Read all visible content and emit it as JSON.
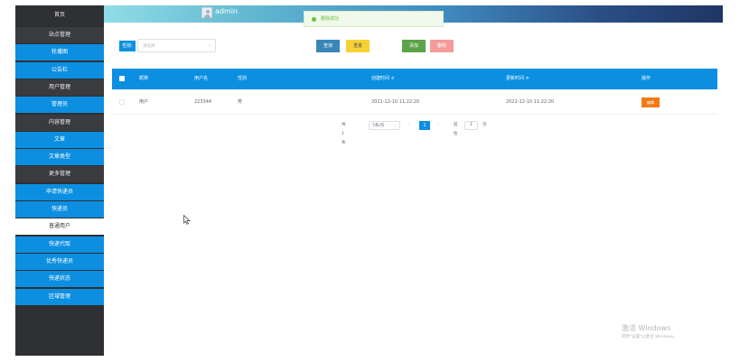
{
  "sidebar": {
    "home": "首页",
    "collapse": "已收缩",
    "items": [
      {
        "label": "站点管理",
        "kind": "cat"
      },
      {
        "label": "轮播图",
        "kind": "sub"
      },
      {
        "label": "公告栏",
        "kind": "sub"
      },
      {
        "label": "用户管理",
        "kind": "cat"
      },
      {
        "label": "管理员",
        "kind": "sub"
      },
      {
        "label": "内容管理",
        "kind": "cat"
      },
      {
        "label": "文章",
        "kind": "sub"
      },
      {
        "label": "文章类型",
        "kind": "sub"
      },
      {
        "label": "更多管理",
        "kind": "cat"
      },
      {
        "label": "申请快递员",
        "kind": "sub"
      },
      {
        "label": "快递员",
        "kind": "sub"
      },
      {
        "label": "普通用户",
        "kind": "active"
      },
      {
        "label": "快递代取",
        "kind": "sub"
      },
      {
        "label": "优秀快递员",
        "kind": "sub"
      },
      {
        "label": "快递状态",
        "kind": "sub"
      },
      {
        "label": "区域管理",
        "kind": "sub"
      }
    ]
  },
  "header": {
    "username": "admin"
  },
  "toast": {
    "message": "删除成功"
  },
  "filter": {
    "gender_label": "性别:",
    "gender_placeholder": "请选择",
    "query": "查询",
    "reset": "重置",
    "add": "添加",
    "delete": "删除"
  },
  "table": {
    "columns": [
      "昵称",
      "用户名",
      "性别",
      "创建时间 ≑",
      "更新时间 ≑",
      "操作"
    ],
    "rows": [
      {
        "nickname": "用户",
        "username": "223344",
        "gender": "男",
        "created": "2021-12-10 11:22:20",
        "updated": "2021-12-10 11:22:20",
        "action": "编辑"
      }
    ]
  },
  "pagination": {
    "total": "共 1 条",
    "page_size": "7条/页",
    "current_page": "1",
    "goto_label": "前往",
    "goto_value": "1",
    "page_unit": "页"
  },
  "watermark": {
    "line1": "激活 Windows",
    "line2": "转到\"设置\"以激活 Windows。"
  }
}
